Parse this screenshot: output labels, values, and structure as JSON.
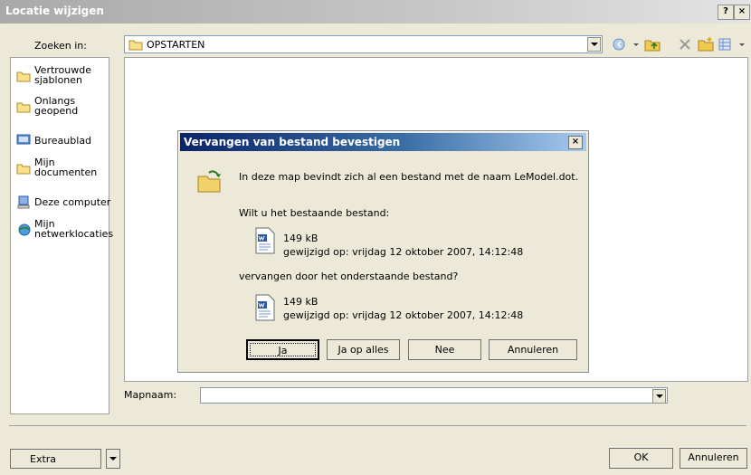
{
  "window": {
    "title": "Locatie wijzigen",
    "help": "?",
    "close": "×"
  },
  "toolbar": {
    "lookin_label": "Zoeken in:",
    "lookin_value": "OPSTARTEN",
    "tool_icons": [
      "back-icon",
      "up-folder-icon",
      "delete-icon",
      "new-folder-icon",
      "views-icon"
    ]
  },
  "places": [
    {
      "label": "Vertrouwde sjablonen",
      "icon": "folder-icon"
    },
    {
      "label": "Onlangs geopend",
      "icon": "folder-icon"
    },
    {
      "label": "Bureaublad",
      "icon": "desktop-icon"
    },
    {
      "label": "Mijn documenten",
      "icon": "folder-icon"
    },
    {
      "label": "Deze computer",
      "icon": "computer-icon"
    },
    {
      "label": "Mijn netwerklocaties",
      "icon": "network-icon"
    }
  ],
  "filename": {
    "label": "Mapnaam:",
    "value": ""
  },
  "bottom": {
    "extra_label": "Extra",
    "ok_label": "OK",
    "cancel_label": "Annuleren"
  },
  "dialog": {
    "title": "Vervangen van bestand bevestigen",
    "close": "×",
    "message": "In deze map bevindt zich al een bestand met de naam LeModel.dot.",
    "question": "Wilt u het bestaande bestand:",
    "existing": {
      "size": "149 kB",
      "modified": "gewijzigd op: vrijdag 12 oktober 2007, 14:12:48"
    },
    "replace_text": "vervangen door het onderstaande bestand?",
    "new": {
      "size": "149 kB",
      "modified": "gewijzigd op: vrijdag 12 oktober 2007, 14:12:48"
    },
    "buttons": {
      "yes": "Ja",
      "yes_all": "Ja op alles",
      "no": "Nee",
      "cancel": "Annuleren"
    }
  },
  "colors": {
    "dialog_title": "#0a246a",
    "window_bg": "#ece9d8",
    "title_inactive": "#a9a9a9"
  }
}
